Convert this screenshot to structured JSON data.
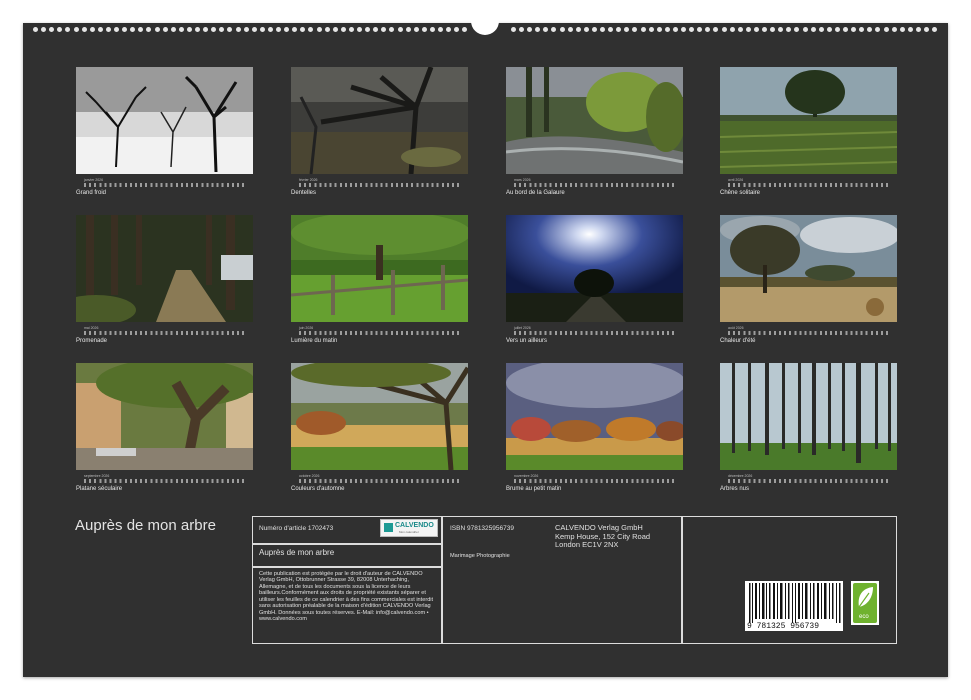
{
  "cover": {
    "title": "Auprès de mon arbre"
  },
  "months": [
    {
      "month": "janvier 2026",
      "caption": "Grand froid"
    },
    {
      "month": "février 2026",
      "caption": "Dentelles"
    },
    {
      "month": "mars 2026",
      "caption": "Au bord de la Galaure"
    },
    {
      "month": "avril 2026",
      "caption": "Chêne solitaire"
    },
    {
      "month": "mai 2026",
      "caption": "Promenade"
    },
    {
      "month": "juin 2026",
      "caption": "Lumière du matin"
    },
    {
      "month": "juillet 2026",
      "caption": "Vers un ailleurs"
    },
    {
      "month": "août 2026",
      "caption": "Chaleur d'été"
    },
    {
      "month": "septembre 2026",
      "caption": "Platane séculaire"
    },
    {
      "month": "octobre 2026",
      "caption": "Couleurs d'automne"
    },
    {
      "month": "novembre 2026",
      "caption": "Brume au petit matin"
    },
    {
      "month": "décembre 2026",
      "caption": "Arbres nus"
    }
  ],
  "info": {
    "article_label": "Numéro d'article 1702473",
    "title": "Auprès de mon arbre",
    "copyright": "Cette publication est protégée par le droit d'auteur de CALVENDO Verlag GmbH, Ottobrunner Strasse 39, 82008 Unterhaching, Allemagne, et de tous les documents sous la licence de leurs bailleurs.Conformément aux droits de propriété existants séparer et utiliser les feuilles de ce calendrier à des fins commerciales est interdit sans autorisation préalable de la maison d'édition CALVENDO Verlag GmbH. Données sous toutes réserves. E-Mail: info@calvendo.com • www.calvendo.com",
    "isbn": "ISBN 9781325956739",
    "publisher_name": "CALVENDO Verlag GmbH",
    "publisher_address1": "Kemp House, 152 City Road",
    "publisher_address2": "London EC1V 2NX",
    "author": "Marimage Photographie",
    "barcode_digits": "9 781325 956739",
    "logo_text": "CALVENDO",
    "logo_sub": "Mon calendrier",
    "eco_label": "eco"
  }
}
